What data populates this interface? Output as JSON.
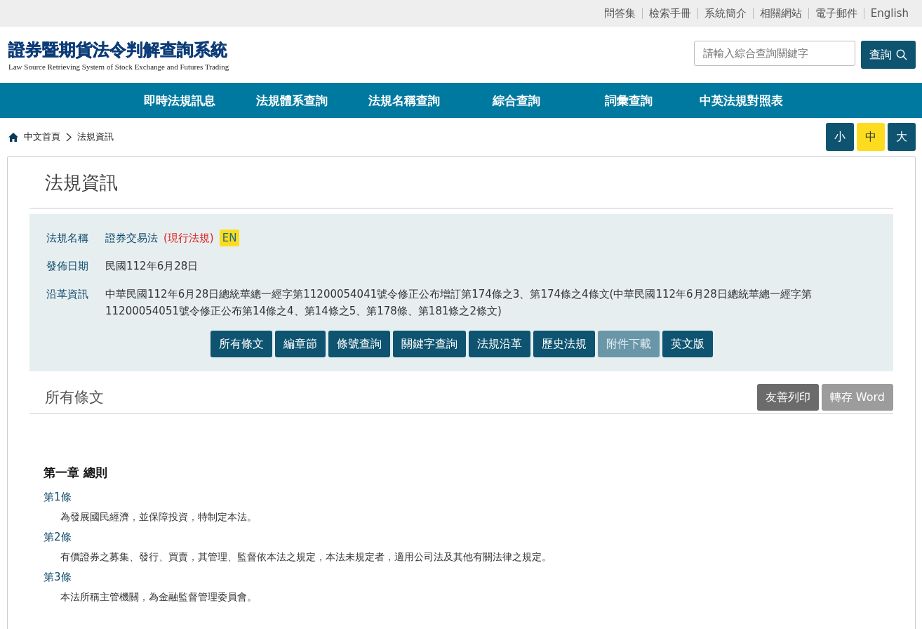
{
  "top_links": [
    {
      "label": "問答集"
    },
    {
      "label": "檢索手冊"
    },
    {
      "label": "系統簡介"
    },
    {
      "label": "相關網站"
    },
    {
      "label": "電子郵件"
    },
    {
      "label": "English"
    }
  ],
  "logo": {
    "title": "證券暨期貨法令判解查詢系統",
    "subtitle": "Law Source Retrieving System of Stock Exchange and Futures Trading"
  },
  "search": {
    "placeholder": "請輸入綜合查詢關鍵字",
    "button": "查詢"
  },
  "nav": [
    {
      "label": "即時法規訊息"
    },
    {
      "label": "法規體系查詢"
    },
    {
      "label": "法規名稱查詢"
    },
    {
      "label": "綜合查詢"
    },
    {
      "label": "詞彙查詢"
    },
    {
      "label": "中英法規對照表"
    }
  ],
  "breadcrumb": [
    {
      "label": "中文首頁"
    },
    {
      "label": "法規資訊"
    }
  ],
  "font_sizes": [
    {
      "label": "小",
      "selected": false
    },
    {
      "label": "中",
      "selected": true
    },
    {
      "label": "大",
      "selected": false
    }
  ],
  "page_title": "法規資訊",
  "info": {
    "name_label": "法規名稱",
    "name": "證券交易法",
    "status": "(現行法規)",
    "en_badge": "EN",
    "date_label": "發佈日期",
    "date": "民國112年6月28日",
    "history_label": "沿革資訊",
    "history": "中華民國112年6月28日總統華總一經字第11200054041號令修正公布增訂第174條之3、第174條之4條文(中華民國112年6月28日總統華總一經字第11200054051號令修正公布第14條之4、第14條之5、第178條、第181條之2條文)"
  },
  "actions": [
    {
      "label": "所有條文",
      "disabled": false
    },
    {
      "label": "編章節",
      "disabled": false
    },
    {
      "label": "條號查詢",
      "disabled": false
    },
    {
      "label": "關鍵字查詢",
      "disabled": false
    },
    {
      "label": "法規沿革",
      "disabled": false
    },
    {
      "label": "歷史法規",
      "disabled": false
    },
    {
      "label": "附件下載",
      "disabled": true
    },
    {
      "label": "英文版",
      "disabled": false
    }
  ],
  "section_title": "所有條文",
  "tools": [
    {
      "label": "友善列印",
      "disabled": false
    },
    {
      "label": "轉存 Word",
      "disabled": true
    }
  ],
  "chapter": "第一章 總則",
  "articles": [
    {
      "number": "第1條",
      "text": "為發展國民經濟，並保障投資，特制定本法。"
    },
    {
      "number": "第2條",
      "text": "有價證券之募集、發行、買賣，其管理、監督依本法之規定，本法未規定者，適用公司法及其他有關法律之規定。"
    },
    {
      "number": "第3條",
      "text": "本法所稱主管機關，為金融監督管理委員會。"
    }
  ]
}
